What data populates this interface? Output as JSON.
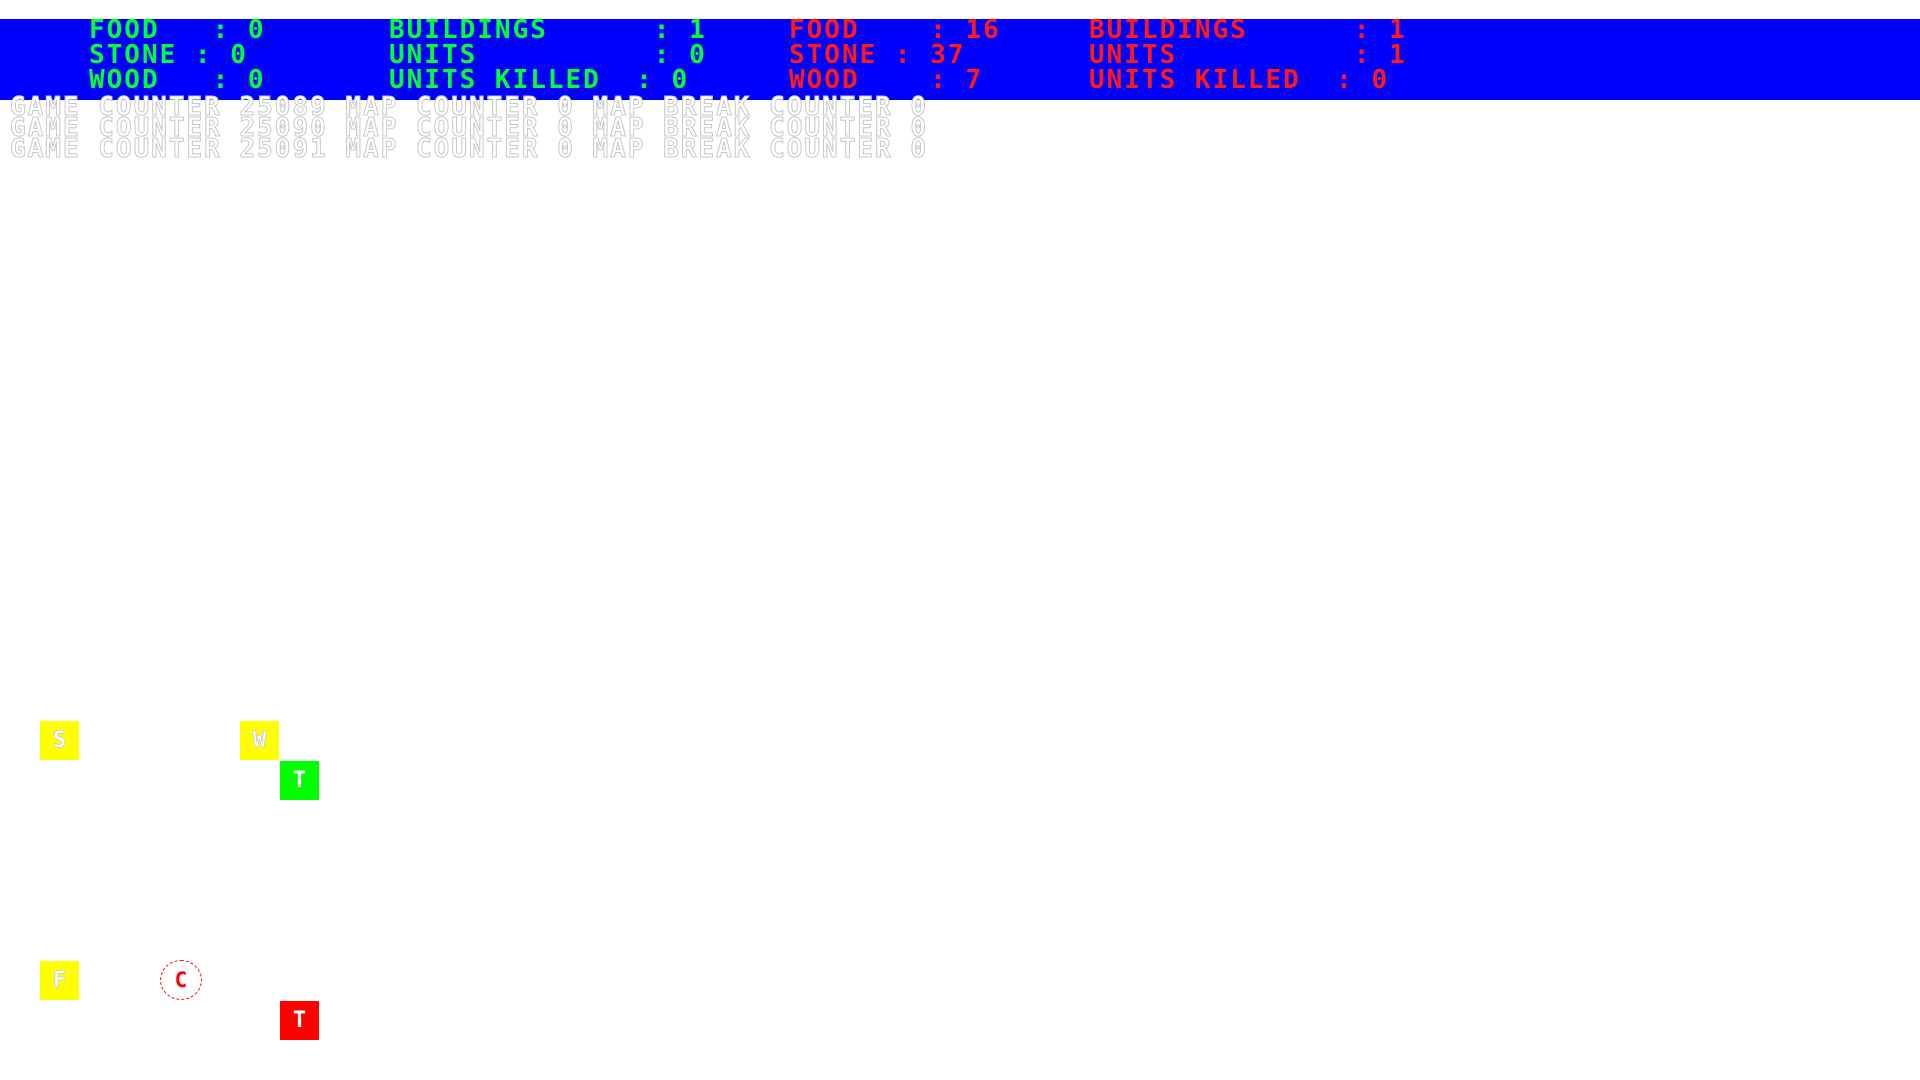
{
  "player_green": {
    "color": "#00ff33",
    "food": "FOOD   : 0",
    "stone": "STONE : 0",
    "wood": "WOOD   : 0",
    "buildings": "BUILDINGS      : 1",
    "units": "UNITS          : 0",
    "units_killed": "UNITS KILLED  : 0"
  },
  "player_red": {
    "color": "#ff1a1a",
    "food": "FOOD    : 16",
    "stone": "STONE : 37",
    "wood": "WOOD    : 7",
    "buildings": "BUILDINGS      : 1",
    "units": "UNITS          : 1",
    "units_killed": "UNITS KILLED  : 0"
  },
  "hud_color": "#0000ff",
  "counters": [
    "GAME COUNTER 25089 MAP COUNTER 0 MAP BREAK COUNTER 0",
    "GAME COUNTER 25090 MAP COUNTER 0 MAP BREAK COUNTER 0",
    "GAME COUNTER 25091 MAP COUNTER 0 MAP BREAK COUNTER 0"
  ],
  "map": {
    "stone_tile": "S",
    "wood_tile": "W",
    "food_tile": "F",
    "green_town": "T",
    "red_town": "T",
    "red_unit": "C"
  }
}
